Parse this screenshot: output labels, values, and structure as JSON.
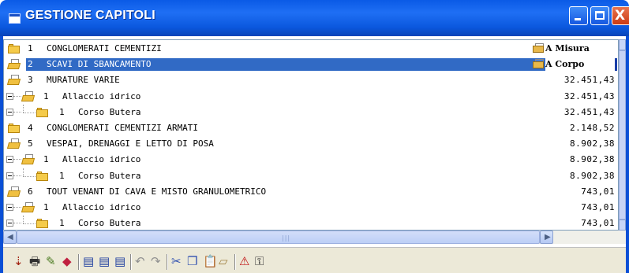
{
  "window": {
    "title": "GESTIONE CAPITOLI",
    "buttons": {
      "minimize": "minimize",
      "maximize": "maximize",
      "close": "X"
    }
  },
  "rows": [
    {
      "level": 0,
      "num": "1",
      "text": "CONGLOMERATI CEMENTIZI",
      "amount": "",
      "tag": "A Misura",
      "selected": false,
      "icon": "folder-closed-icon"
    },
    {
      "level": 0,
      "num": "2",
      "text": "SCAVI DI SBANCAMENTO",
      "amount": "",
      "tag": "A Corpo",
      "selected": true,
      "icon": "folder-open-icon"
    },
    {
      "level": 0,
      "num": "3",
      "text": "MURATURE VARIE",
      "amount": "32.451,43",
      "tag": "",
      "selected": false,
      "icon": "folder-open-icon"
    },
    {
      "level": 1,
      "num": "1",
      "text": "Allaccio idrico",
      "amount": "32.451,43",
      "tag": "",
      "selected": false,
      "icon": "folder-open-icon"
    },
    {
      "level": 2,
      "num": "1",
      "text": "Corso Butera",
      "amount": "32.451,43",
      "tag": "",
      "selected": false,
      "icon": "folder-closed-icon"
    },
    {
      "level": 0,
      "num": "4",
      "text": "CONGLOMERATI CEMENTIZI ARMATI",
      "amount": "2.148,52",
      "tag": "",
      "selected": false,
      "icon": "folder-closed-icon"
    },
    {
      "level": 0,
      "num": "5",
      "text": "VESPAI, DRENAGGI E LETTO DI POSA",
      "amount": "8.902,38",
      "tag": "",
      "selected": false,
      "icon": "folder-open-icon"
    },
    {
      "level": 1,
      "num": "1",
      "text": "Allaccio idrico",
      "amount": "8.902,38",
      "tag": "",
      "selected": false,
      "icon": "folder-open-icon"
    },
    {
      "level": 2,
      "num": "1",
      "text": "Corso Butera",
      "amount": "8.902,38",
      "tag": "",
      "selected": false,
      "icon": "folder-closed-icon"
    },
    {
      "level": 0,
      "num": "6",
      "text": "TOUT VENANT DI CAVA E MISTO GRANULOMETRICO",
      "amount": "743,01",
      "tag": "",
      "selected": false,
      "icon": "folder-open-icon"
    },
    {
      "level": 1,
      "num": "1",
      "text": "Allaccio idrico",
      "amount": "743,01",
      "tag": "",
      "selected": false,
      "icon": "folder-open-icon"
    },
    {
      "level": 2,
      "num": "1",
      "text": "Corso Butera",
      "amount": "743,01",
      "tag": "",
      "selected": false,
      "icon": "folder-closed-icon"
    }
  ],
  "toolbar": {
    "tools": [
      {
        "name": "import-icon",
        "glyph": "⇣",
        "color": "#a02010"
      },
      {
        "name": "print-icon",
        "glyph": "🖶",
        "color": "#303030"
      },
      {
        "name": "edit-icon",
        "glyph": "✎",
        "color": "#4a7a20"
      },
      {
        "name": "eraser-icon",
        "glyph": "◆",
        "color": "#c02040"
      },
      {
        "name": "document-1-icon",
        "glyph": "▤",
        "color": "#2040a0"
      },
      {
        "name": "document-2-icon",
        "glyph": "▤",
        "color": "#2040a0"
      },
      {
        "name": "document-3-icon",
        "glyph": "▤",
        "color": "#2040a0"
      },
      {
        "name": "undo-icon",
        "glyph": "↶",
        "color": "#909090"
      },
      {
        "name": "redo-icon",
        "glyph": "↷",
        "color": "#909090"
      },
      {
        "name": "cut-icon",
        "glyph": "✂",
        "color": "#3050b0"
      },
      {
        "name": "copy-icon",
        "glyph": "❐",
        "color": "#3050b0"
      },
      {
        "name": "paste-icon",
        "glyph": "📋",
        "color": "#8a6a20"
      },
      {
        "name": "open-folder-icon",
        "glyph": "▱",
        "color": "#a08040"
      },
      {
        "name": "warning-icon",
        "glyph": "⚠",
        "color": "#c01010"
      },
      {
        "name": "lock-icon",
        "glyph": "⚿",
        "color": "#303030"
      }
    ]
  },
  "colors": {
    "selection": "#316ac5",
    "titlebar": "#0a5ae6",
    "folder": "#f5cb4a"
  }
}
